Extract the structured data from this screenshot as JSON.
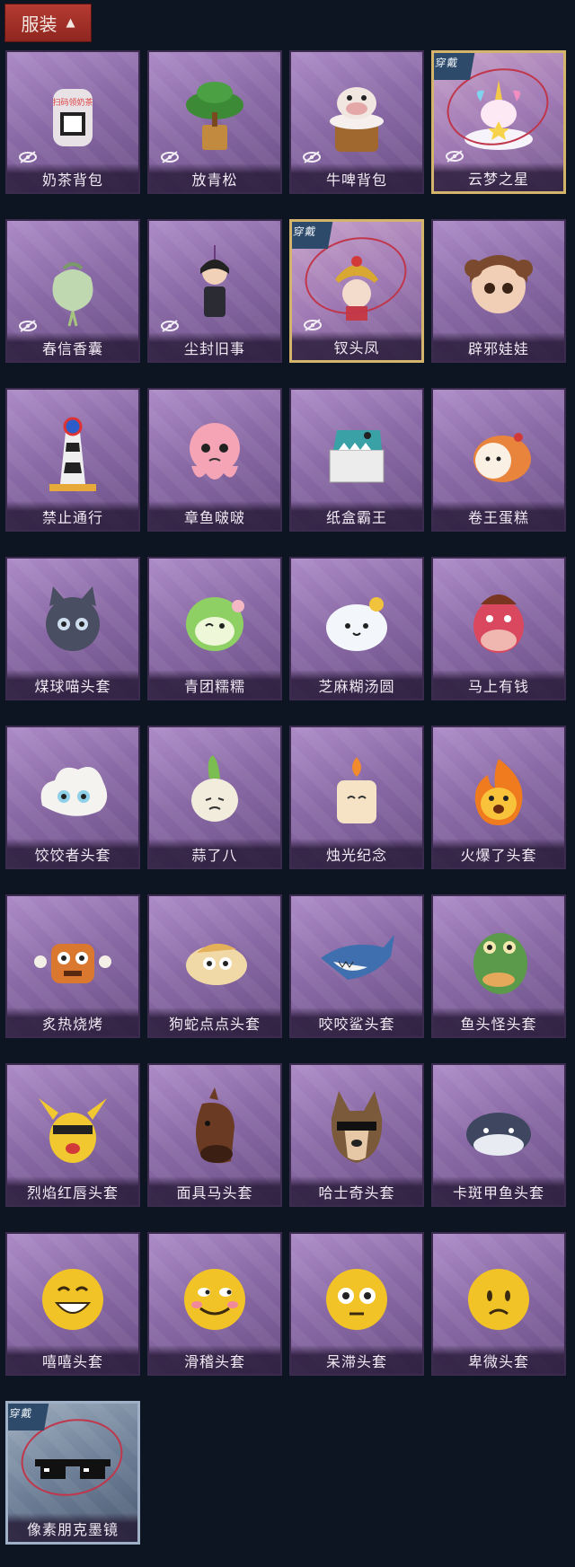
{
  "header": {
    "label": "服装",
    "icon": "chevron-up-icon"
  },
  "badge_text": "穿戴",
  "items": [
    {
      "name": "奶茶背包",
      "hidden": true,
      "worn": false,
      "icon": "milk-tea-backpack-icon",
      "art": "tea"
    },
    {
      "name": "放青松",
      "hidden": true,
      "worn": false,
      "icon": "potted-pine-icon",
      "art": "pine"
    },
    {
      "name": "牛啤背包",
      "hidden": true,
      "worn": false,
      "icon": "cow-beer-backpack-icon",
      "art": "cow"
    },
    {
      "name": "云梦之星",
      "hidden": true,
      "worn": true,
      "icon": "unicorn-cloud-icon",
      "art": "unicorn"
    },
    {
      "name": "春信香囊",
      "hidden": true,
      "worn": false,
      "icon": "sachet-icon",
      "art": "sachet"
    },
    {
      "name": "尘封旧事",
      "hidden": true,
      "worn": false,
      "icon": "figurine-charm-icon",
      "art": "figure"
    },
    {
      "name": "钗头凤",
      "hidden": true,
      "worn": true,
      "icon": "phoenix-crown-icon",
      "art": "crown"
    },
    {
      "name": "辟邪娃娃",
      "hidden": false,
      "worn": false,
      "icon": "doll-head-icon",
      "art": "doll"
    },
    {
      "name": "禁止通行",
      "hidden": false,
      "worn": false,
      "icon": "traffic-cone-icon",
      "art": "cone"
    },
    {
      "name": "章鱼啵啵",
      "hidden": false,
      "worn": false,
      "icon": "octopus-icon",
      "art": "octopus"
    },
    {
      "name": "纸盒霸王",
      "hidden": false,
      "worn": false,
      "icon": "box-dino-icon",
      "art": "dino"
    },
    {
      "name": "卷王蛋糕",
      "hidden": false,
      "worn": false,
      "icon": "roll-cake-icon",
      "art": "cake"
    },
    {
      "name": "煤球喵头套",
      "hidden": false,
      "worn": false,
      "icon": "cat-head-icon",
      "art": "cat"
    },
    {
      "name": "青团糯糯",
      "hidden": false,
      "worn": false,
      "icon": "green-mochi-icon",
      "art": "mochi"
    },
    {
      "name": "芝麻糊汤圆",
      "hidden": false,
      "worn": false,
      "icon": "tangyuan-icon",
      "art": "tangyuan"
    },
    {
      "name": "马上有钱",
      "hidden": false,
      "worn": false,
      "icon": "horse-head-icon",
      "art": "pinkhorse"
    },
    {
      "name": "饺饺者头套",
      "hidden": false,
      "worn": false,
      "icon": "dumpling-head-icon",
      "art": "dumpling"
    },
    {
      "name": "蒜了八",
      "hidden": false,
      "worn": false,
      "icon": "garlic-icon",
      "art": "garlic"
    },
    {
      "name": "烛光纪念",
      "hidden": false,
      "worn": false,
      "icon": "candle-icon",
      "art": "candle"
    },
    {
      "name": "火爆了头套",
      "hidden": false,
      "worn": false,
      "icon": "flame-head-icon",
      "art": "flame"
    },
    {
      "name": "炙热烧烤",
      "hidden": false,
      "worn": false,
      "icon": "bbq-meat-icon",
      "art": "meat"
    },
    {
      "name": "狗蛇点点头套",
      "hidden": false,
      "worn": false,
      "icon": "snake-head-icon",
      "art": "snake"
    },
    {
      "name": "咬咬鲨头套",
      "hidden": false,
      "worn": false,
      "icon": "shark-icon",
      "art": "shark"
    },
    {
      "name": "鱼头怪头套",
      "hidden": false,
      "worn": false,
      "icon": "fish-head-icon",
      "art": "fish"
    },
    {
      "name": "烈焰红唇头套",
      "hidden": false,
      "worn": false,
      "icon": "yellow-mouse-head-icon",
      "art": "pika"
    },
    {
      "name": "面具马头套",
      "hidden": false,
      "worn": false,
      "icon": "horse-mask-icon",
      "art": "horse"
    },
    {
      "name": "哈士奇头套",
      "hidden": false,
      "worn": false,
      "icon": "husky-head-icon",
      "art": "husky"
    },
    {
      "name": "卡斑甲鱼头套",
      "hidden": false,
      "worn": false,
      "icon": "whale-head-icon",
      "art": "whale"
    },
    {
      "name": "嘻嘻头套",
      "hidden": false,
      "worn": false,
      "icon": "grin-emoji-icon",
      "art": "emoji_grin"
    },
    {
      "name": "滑稽头套",
      "hidden": false,
      "worn": false,
      "icon": "smirk-emoji-icon",
      "art": "emoji_smirk"
    },
    {
      "name": "呆滞头套",
      "hidden": false,
      "worn": false,
      "icon": "dazed-emoji-icon",
      "art": "emoji_dazed"
    },
    {
      "name": "卑微头套",
      "hidden": false,
      "worn": false,
      "icon": "humble-emoji-icon",
      "art": "emoji_humble"
    },
    {
      "name": "像素朋克墨镜",
      "hidden": false,
      "worn": true,
      "icon": "pixel-sunglasses-icon",
      "art": "shades",
      "blue": true
    }
  ]
}
